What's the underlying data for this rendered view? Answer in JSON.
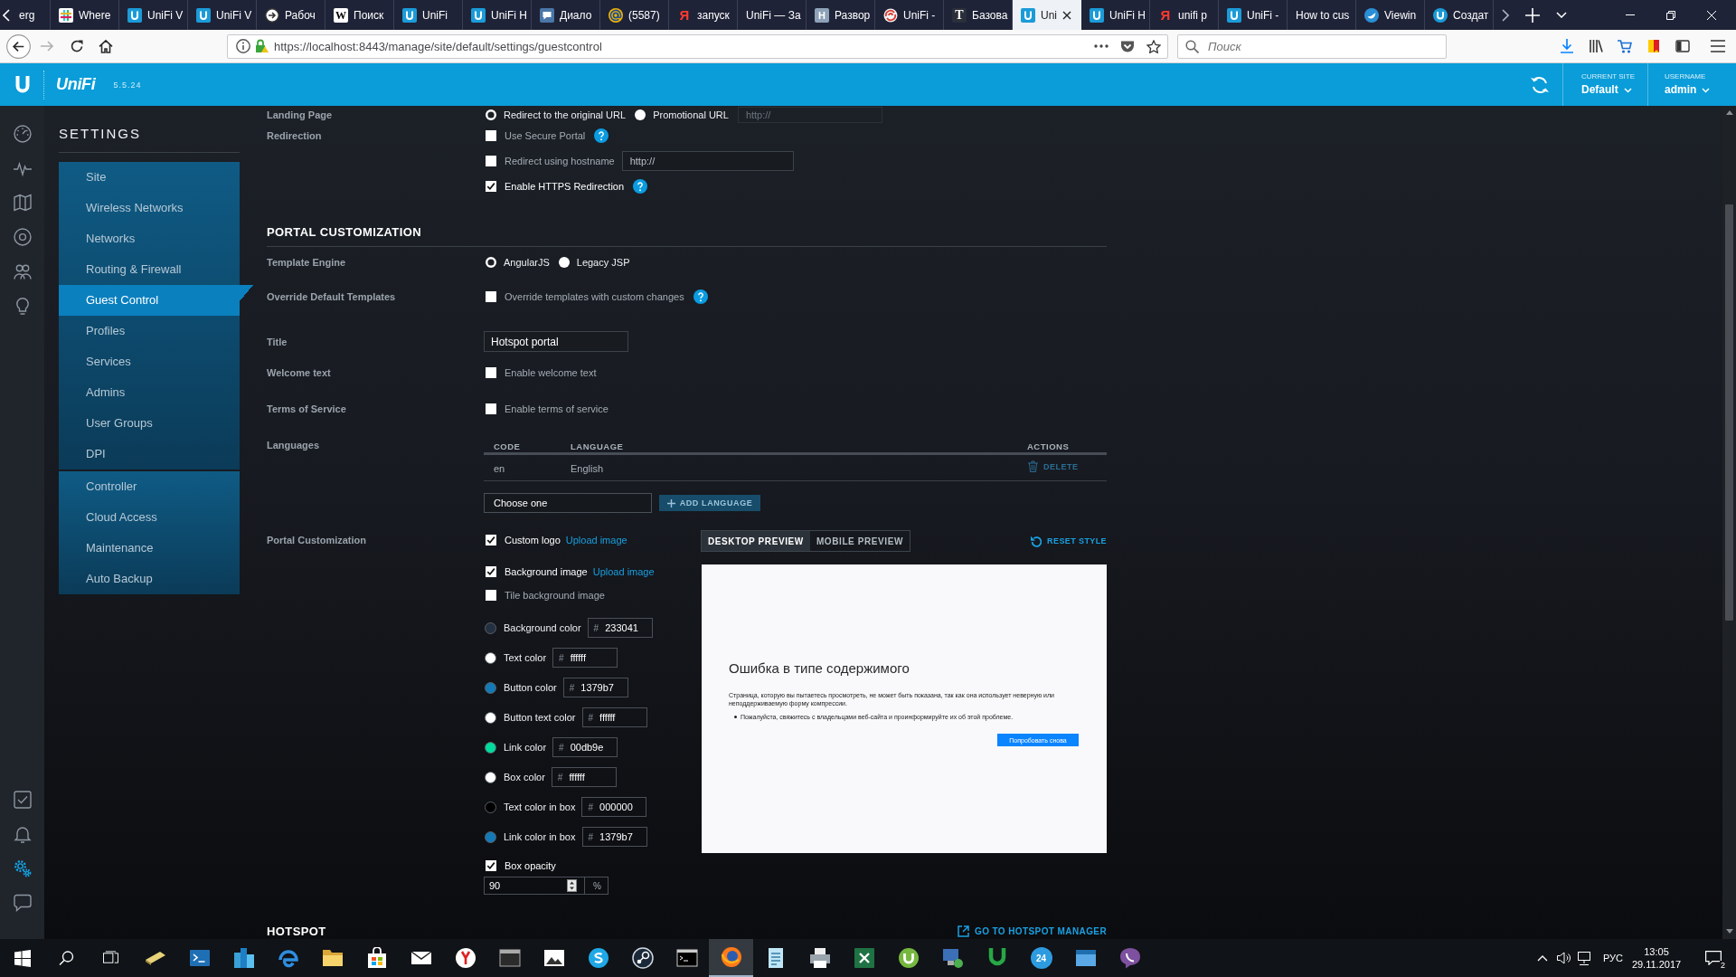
{
  "browser": {
    "tabs": [
      {
        "title": "erg",
        "kind": "none",
        "selected": false
      },
      {
        "title": "Where",
        "kind": "grid",
        "selected": false
      },
      {
        "title": "UniFi V",
        "kind": "unifi",
        "selected": false
      },
      {
        "title": "UniFi V",
        "kind": "unifi",
        "selected": false
      },
      {
        "title": "Рабоч",
        "kind": "arrow",
        "selected": false
      },
      {
        "title": "Поиск",
        "kind": "tile-light",
        "glyph": "W",
        "selected": false
      },
      {
        "title": "UniFi",
        "kind": "unifi",
        "selected": false
      },
      {
        "title": "UniFi H",
        "kind": "unifi",
        "selected": false
      },
      {
        "title": "Диало",
        "kind": "chat",
        "selected": false
      },
      {
        "title": "(5587)",
        "kind": "at",
        "selected": false
      },
      {
        "title": "запуск",
        "kind": "glyph-red",
        "glyph": "Я",
        "selected": false
      },
      {
        "title": "UniFi — За",
        "kind": "none",
        "selected": false
      },
      {
        "title": "Развор",
        "kind": "tile-grey",
        "glyph": "H",
        "selected": false
      },
      {
        "title": "UniFi -",
        "kind": "swirl",
        "selected": false
      },
      {
        "title": "Базова",
        "kind": "tile-dark",
        "glyph": "T",
        "selected": false
      },
      {
        "title": "Uni",
        "kind": "unifi",
        "selected": true
      },
      {
        "title": "UniFi H",
        "kind": "unifi",
        "selected": false
      },
      {
        "title": "unifi p",
        "kind": "glyph-red",
        "glyph": "Я",
        "selected": false
      },
      {
        "title": "UniFi -",
        "kind": "unifi",
        "selected": false
      },
      {
        "title": "How to cus",
        "kind": "none",
        "selected": false
      },
      {
        "title": "Viewin",
        "kind": "bird",
        "selected": false
      },
      {
        "title": "Создат",
        "kind": "unifi-round",
        "selected": false
      }
    ],
    "url": "https://localhost:8443/manage/site/default/settings/guestcontrol",
    "search": {
      "placeholder": "Поиск"
    }
  },
  "app_header": {
    "logo": "UniFi",
    "version": "5.5.24",
    "site": {
      "label": "CURRENT SITE",
      "value": "Default"
    },
    "user": {
      "label": "USERNAME",
      "value": "admin"
    }
  },
  "nav_rail": {
    "top": [
      {
        "kind": "dashboard",
        "selected": false
      },
      {
        "kind": "statistics",
        "selected": false
      },
      {
        "kind": "map",
        "selected": false
      },
      {
        "kind": "devices",
        "selected": false
      },
      {
        "kind": "clients",
        "selected": false
      },
      {
        "kind": "insights",
        "selected": false
      }
    ],
    "bottom": [
      {
        "kind": "tasks",
        "selected": false
      },
      {
        "kind": "alerts",
        "selected": false
      },
      {
        "kind": "settings",
        "selected": true
      },
      {
        "kind": "chat",
        "selected": false
      }
    ]
  },
  "sidebar": {
    "title": "SETTINGS",
    "groups": [
      {
        "items": [
          {
            "label": "Site",
            "selected": false
          },
          {
            "label": "Wireless Networks",
            "selected": false
          },
          {
            "label": "Networks",
            "selected": false
          },
          {
            "label": "Routing & Firewall",
            "selected": false
          },
          {
            "label": "Guest Control",
            "selected": true
          },
          {
            "label": "Profiles",
            "selected": false
          },
          {
            "label": "Services",
            "selected": false
          },
          {
            "label": "Admins",
            "selected": false
          },
          {
            "label": "User Groups",
            "selected": false
          },
          {
            "label": "DPI",
            "selected": false
          }
        ]
      },
      {
        "items": [
          {
            "label": "Controller",
            "selected": false
          },
          {
            "label": "Cloud Access",
            "selected": false
          },
          {
            "label": "Maintenance",
            "selected": false
          },
          {
            "label": "Auto Backup",
            "selected": false
          }
        ]
      }
    ]
  },
  "form": {
    "landing": {
      "label": "Landing Page",
      "options": [
        {
          "label": "Redirect to the original URL",
          "selected": true
        },
        {
          "label": "Promotional URL",
          "selected": false
        }
      ],
      "url_field": {
        "placeholder": "http://",
        "disabled": true
      }
    },
    "redirection": {
      "label": "Redirection",
      "options": [
        {
          "label": "Use Secure Portal",
          "checked": false,
          "help": true
        },
        {
          "label": "Redirect using hostname",
          "checked": false,
          "field": {
            "placeholder": "http://"
          }
        },
        {
          "label": "Enable HTTPS Redirection",
          "checked": true,
          "help": true
        }
      ]
    },
    "section_title": "PORTAL CUSTOMIZATION",
    "template_engine": {
      "label": "Template Engine",
      "options": [
        {
          "label": "AngularJS",
          "selected": true
        },
        {
          "label": "Legacy JSP",
          "selected": false
        }
      ]
    },
    "override": {
      "label": "Override Default Templates",
      "option": {
        "label": "Override templates with custom changes",
        "checked": false,
        "help": true
      }
    },
    "title": {
      "label": "Title",
      "value": "Hotspot portal"
    },
    "welcome": {
      "label": "Welcome text",
      "option": {
        "label": "Enable welcome text",
        "checked": false
      }
    },
    "terms": {
      "label": "Terms of Service",
      "option": {
        "label": "Enable terms of service",
        "checked": false
      }
    },
    "languages": {
      "label": "Languages",
      "columns": [
        "CODE",
        "LANGUAGE",
        "ACTIONS"
      ],
      "rows": [
        {
          "code": "en",
          "language": "English",
          "action": "DELETE"
        }
      ],
      "select": {
        "value": "Choose one"
      },
      "add_button": {
        "label": "ADD LANGUAGE",
        "disabled": true
      }
    },
    "portal": {
      "label": "Portal Customization",
      "images": [
        {
          "label": "Custom logo",
          "checked": true,
          "link": "Upload image"
        },
        {
          "label": "Background image",
          "checked": true,
          "link": "Upload image"
        },
        {
          "label": "Tile background image",
          "checked": false
        }
      ],
      "colors": [
        {
          "label": "Background color",
          "color": "#233041",
          "prefix": "#",
          "value": "233041"
        },
        {
          "label": "Text color",
          "color": "#ffffff",
          "prefix": "#",
          "value": "ffffff"
        },
        {
          "label": "Button color",
          "color": "#1379b7",
          "prefix": "#",
          "value": "1379b7"
        },
        {
          "label": "Button text color",
          "color": "#ffffff",
          "prefix": "#",
          "value": "ffffff"
        },
        {
          "label": "Link color",
          "color": "#00db9e",
          "prefix": "#",
          "value": "00db9e"
        },
        {
          "label": "Box color",
          "color": "#ffffff",
          "prefix": "#",
          "value": "ffffff"
        },
        {
          "label": "Text color in box",
          "color": "#000000",
          "prefix": "#",
          "value": "000000"
        },
        {
          "label": "Link color in box",
          "color": "#1379b7",
          "prefix": "#",
          "value": "1379b7"
        }
      ],
      "opacity": {
        "label": "Box opacity",
        "checked": true,
        "value": "90",
        "unit": "%"
      },
      "preview_tabs": [
        {
          "label": "DESKTOP PREVIEW",
          "selected": true
        },
        {
          "label": "MOBILE PREVIEW",
          "selected": false
        }
      ],
      "reset": "RESET STYLE",
      "preview": {
        "heading": "Ошибка в типе содержимого",
        "text": "Страница, которую вы пытаетесь просмотреть, не может быть показана, так как она использует неверную или неподдерживаемую форму компрессии.",
        "bullets": [
          "Пожалуйста, свяжитесь с владельцами веб-сайта и проинформируйте их об этой проблеме."
        ],
        "button": "Попробовать снова"
      }
    },
    "hotspot": {
      "title": "HOTSPOT",
      "link": "GO TO HOTSPOT MANAGER"
    }
  },
  "taskbar": {
    "apps": [
      {
        "kind": "card",
        "selected": false
      },
      {
        "kind": "terminal",
        "selected": false
      },
      {
        "kind": "blocks",
        "selected": false
      },
      {
        "kind": "browser",
        "selected": false
      },
      {
        "kind": "folder",
        "selected": false
      },
      {
        "kind": "bag",
        "selected": false
      },
      {
        "kind": "mail",
        "selected": false
      },
      {
        "kind": "ybrowser",
        "selected": false
      },
      {
        "kind": "console",
        "selected": false
      },
      {
        "kind": "photos",
        "selected": false
      },
      {
        "kind": "bubble",
        "selected": false
      },
      {
        "kind": "disc",
        "selected": false
      },
      {
        "kind": "cmd",
        "selected": false
      },
      {
        "kind": "firefox",
        "selected": true
      },
      {
        "kind": "notepad",
        "selected": false
      },
      {
        "kind": "printer",
        "selected": false
      },
      {
        "kind": "sheet",
        "selected": false
      },
      {
        "kind": "roundlogo",
        "selected": false
      },
      {
        "kind": "computer",
        "selected": false
      },
      {
        "kind": "magnet",
        "selected": false
      },
      {
        "kind": "number",
        "glyph": "24",
        "selected": false
      },
      {
        "kind": "window",
        "selected": false
      },
      {
        "kind": "phone",
        "selected": false
      }
    ],
    "tray": {
      "language": "РУС",
      "time": "13:05",
      "date": "29.11.2017",
      "notifications": "2"
    }
  }
}
